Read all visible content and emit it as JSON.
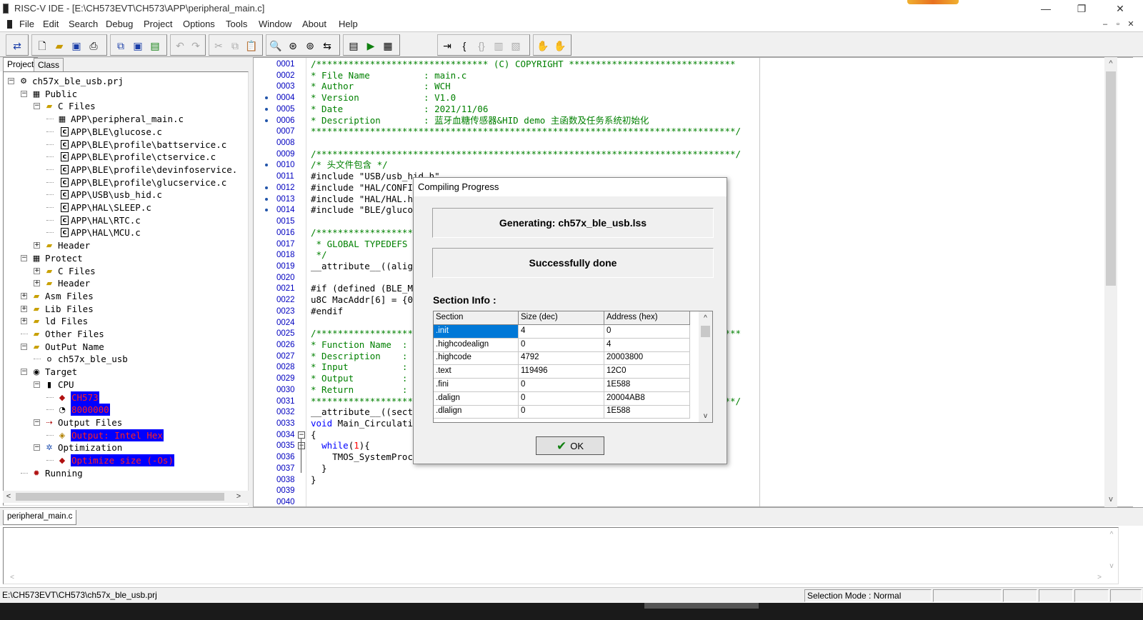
{
  "window": {
    "title": "RISC-V IDE - [E:\\CH573EVT\\CH573\\APP\\peripheral_main.c]",
    "controls": [
      "—",
      "❐",
      "✕"
    ],
    "mdi_controls": [
      "–",
      "▫",
      "✕"
    ]
  },
  "menu": [
    "File",
    "Edit",
    "Search",
    "Debug",
    "Project",
    "Options",
    "Tools",
    "Window",
    "About",
    "Help"
  ],
  "project_tabs": [
    "Project",
    "Class"
  ],
  "tree": [
    {
      "level": 0,
      "exp": "−",
      "icon": "project-icon",
      "glyph": "⚙",
      "label": "ch57x_ble_usb.prj"
    },
    {
      "level": 1,
      "exp": "−",
      "icon": "group-icon",
      "glyph": "▦",
      "label": "Public"
    },
    {
      "level": 2,
      "exp": "−",
      "icon": "folder-icon",
      "glyph": "▰",
      "label": "C Files"
    },
    {
      "level": 3,
      "exp": "",
      "icon": "active-file-icon",
      "glyph": "▦",
      "label": "APP\\peripheral_main.c"
    },
    {
      "level": 3,
      "exp": "",
      "icon": "c-file-icon",
      "glyph": "c",
      "label": "APP\\BLE\\glucose.c"
    },
    {
      "level": 3,
      "exp": "",
      "icon": "c-file-icon",
      "glyph": "c",
      "label": "APP\\BLE\\profile\\battservice.c"
    },
    {
      "level": 3,
      "exp": "",
      "icon": "c-file-icon",
      "glyph": "c",
      "label": "APP\\BLE\\profile\\ctservice.c"
    },
    {
      "level": 3,
      "exp": "",
      "icon": "c-file-icon",
      "glyph": "c",
      "label": "APP\\BLE\\profile\\devinfoservice."
    },
    {
      "level": 3,
      "exp": "",
      "icon": "c-file-icon",
      "glyph": "c",
      "label": "APP\\BLE\\profile\\glucservice.c"
    },
    {
      "level": 3,
      "exp": "",
      "icon": "c-file-icon",
      "glyph": "c",
      "label": "APP\\USB\\usb_hid.c"
    },
    {
      "level": 3,
      "exp": "",
      "icon": "c-file-icon",
      "glyph": "c",
      "label": "APP\\HAL\\SLEEP.c"
    },
    {
      "level": 3,
      "exp": "",
      "icon": "c-file-icon",
      "glyph": "c",
      "label": "APP\\HAL\\RTC.c"
    },
    {
      "level": 3,
      "exp": "",
      "icon": "c-file-icon",
      "glyph": "c",
      "label": "APP\\HAL\\MCU.c"
    },
    {
      "level": 2,
      "exp": "+",
      "icon": "folder-icon",
      "glyph": "▰",
      "label": "Header"
    },
    {
      "level": 1,
      "exp": "−",
      "icon": "group-icon",
      "glyph": "▦",
      "label": "Protect"
    },
    {
      "level": 2,
      "exp": "+",
      "icon": "folder-icon",
      "glyph": "▰",
      "label": "C Files"
    },
    {
      "level": 2,
      "exp": "+",
      "icon": "folder-icon",
      "glyph": "▰",
      "label": "Header"
    },
    {
      "level": 1,
      "exp": "+",
      "icon": "folder-icon",
      "glyph": "▰",
      "label": "Asm Files"
    },
    {
      "level": 1,
      "exp": "+",
      "icon": "folder-icon",
      "glyph": "▰",
      "label": "Lib Files"
    },
    {
      "level": 1,
      "exp": "+",
      "icon": "folder-icon",
      "glyph": "▰",
      "label": "ld Files"
    },
    {
      "level": 1,
      "exp": "",
      "icon": "folder-icon",
      "glyph": "▰",
      "label": "Other Files"
    },
    {
      "level": 1,
      "exp": "−",
      "icon": "folder-icon",
      "glyph": "▰",
      "label": "OutPut Name"
    },
    {
      "level": 2,
      "exp": "",
      "icon": "output-icon",
      "glyph": "o",
      "label": "ch57x_ble_usb"
    },
    {
      "level": 1,
      "exp": "−",
      "icon": "target-icon",
      "glyph": "◉",
      "label": "Target"
    },
    {
      "level": 2,
      "exp": "−",
      "icon": "cpu-icon",
      "glyph": "▮",
      "label": "CPU"
    },
    {
      "level": 3,
      "exp": "",
      "icon": "chip-icon",
      "glyph": "◆",
      "label": "CH573",
      "highlight": true
    },
    {
      "level": 3,
      "exp": "",
      "icon": "clock-icon",
      "glyph": "◔",
      "label": "8000000",
      "highlight": true
    },
    {
      "level": 2,
      "exp": "−",
      "icon": "output-files-icon",
      "glyph": "⇢",
      "label": "Output Files"
    },
    {
      "level": 3,
      "exp": "",
      "icon": "hex-icon",
      "glyph": "◈",
      "label": "Output: Intel Hex",
      "highlight": true
    },
    {
      "level": 2,
      "exp": "−",
      "icon": "optimization-icon",
      "glyph": "✲",
      "label": "Optimization"
    },
    {
      "level": 3,
      "exp": "",
      "icon": "optimize-icon",
      "glyph": "◆",
      "label": "Optimize size (-Os)",
      "highlight": true
    },
    {
      "level": 1,
      "exp": "",
      "icon": "running-icon",
      "glyph": "✹",
      "label": "Running"
    }
  ],
  "editor": {
    "lines": [
      {
        "n": "0001",
        "dot": false,
        "t": "/******************************** (C) COPYRIGHT *******************************",
        "c": "cm"
      },
      {
        "n": "0002",
        "dot": false,
        "t": "* File Name          : main.c",
        "c": "cm"
      },
      {
        "n": "0003",
        "dot": false,
        "t": "* Author             : WCH",
        "c": "cm"
      },
      {
        "n": "0004",
        "dot": true,
        "t": "* Version            : V1.0",
        "c": "cm"
      },
      {
        "n": "0005",
        "dot": true,
        "t": "* Date               : 2021/11/06",
        "c": "cm"
      },
      {
        "n": "0006",
        "dot": true,
        "t": "* Description        : 蓝牙血糖传感器&HID demo 主函数及任务系统初始化",
        "c": "cm"
      },
      {
        "n": "0007",
        "dot": false,
        "t": "*******************************************************************************/",
        "c": "cm"
      },
      {
        "n": "0008",
        "dot": false,
        "t": "",
        "c": ""
      },
      {
        "n": "0009",
        "dot": false,
        "t": "/******************************************************************************/",
        "c": "cm"
      },
      {
        "n": "0010",
        "dot": true,
        "t": "/* 头文件包含 */",
        "c": "cm"
      },
      {
        "n": "0011",
        "dot": false,
        "t": "#include \"USB/usb_hid.h\"",
        "c": "pp"
      },
      {
        "n": "0012",
        "dot": true,
        "t": "#include \"HAL/CONFIG.h\"",
        "c": "pp"
      },
      {
        "n": "0013",
        "dot": true,
        "t": "#include \"HAL/HAL.h\"",
        "c": "pp"
      },
      {
        "n": "0014",
        "dot": true,
        "t": "#include \"BLE/glucose.h\"",
        "c": "pp"
      },
      {
        "n": "0015",
        "dot": false,
        "t": "",
        "c": ""
      },
      {
        "n": "0016",
        "dot": false,
        "t": "/*********************************************************************",
        "c": "cm"
      },
      {
        "n": "0017",
        "dot": false,
        "t": " * GLOBAL TYPEDEFS",
        "c": "cm"
      },
      {
        "n": "0018",
        "dot": false,
        "t": " */",
        "c": "cm"
      },
      {
        "n": "0019",
        "dot": false,
        "t": "__attribute__((aligned(4))) u32 MEM_BUF[BLE_MEMHEAP_SIZE/4];",
        "c": ""
      },
      {
        "n": "0020",
        "dot": false,
        "t": "",
        "c": ""
      },
      {
        "n": "0021",
        "dot": false,
        "t": "#if (defined (BLE_MAC)) && (BLE_MAC == TRUE)",
        "c": "pp"
      },
      {
        "n": "0022",
        "dot": false,
        "t": "u8C MacAddr[6] = {0x84,0xC2,0xE4,0x03,0x02,0x02};",
        "c": ""
      },
      {
        "n": "0023",
        "dot": false,
        "t": "#endif",
        "c": "pp"
      },
      {
        "n": "0024",
        "dot": false,
        "t": "",
        "c": ""
      },
      {
        "n": "0025",
        "dot": false,
        "t": "/*******************************************************************************",
        "c": "cm"
      },
      {
        "n": "0026",
        "dot": false,
        "t": "* Function Name  : Main_Circulation",
        "c": "cm"
      },
      {
        "n": "0027",
        "dot": false,
        "t": "* Description    : 主循环",
        "c": "cm"
      },
      {
        "n": "0028",
        "dot": false,
        "t": "* Input          : None",
        "c": "cm"
      },
      {
        "n": "0029",
        "dot": false,
        "t": "* Output         : None",
        "c": "cm"
      },
      {
        "n": "0030",
        "dot": false,
        "t": "* Return         : None",
        "c": "cm"
      },
      {
        "n": "0031",
        "dot": false,
        "t": "*******************************************************************************/",
        "c": "cm"
      },
      {
        "n": "0032",
        "dot": false,
        "t": "__attribute__((section(\".highcode\")))",
        "c": ""
      },
      {
        "n": "0033",
        "dot": false,
        "t": "void Main_Circulation()",
        "c": "kwline"
      },
      {
        "n": "0034",
        "dot": false,
        "t": "{",
        "c": "",
        "fold": "−"
      },
      {
        "n": "0035",
        "dot": false,
        "t": "  while(1){",
        "c": "while",
        "fold": "−"
      },
      {
        "n": "0036",
        "dot": false,
        "t": "    TMOS_SystemProcess( );",
        "c": ""
      },
      {
        "n": "0037",
        "dot": false,
        "t": "  }",
        "c": ""
      },
      {
        "n": "0038",
        "dot": false,
        "t": "}",
        "c": ""
      },
      {
        "n": "0039",
        "dot": false,
        "t": "",
        "c": ""
      },
      {
        "n": "0040",
        "dot": false,
        "t": "",
        "c": ""
      }
    ]
  },
  "file_tab": "peripheral_main.c",
  "status": {
    "path": "E:\\CH573EVT\\CH573\\ch57x_ble_usb.prj",
    "mode": "Selection Mode : Normal"
  },
  "dialog": {
    "title": "Compiling Progress",
    "generating": "Generating: ch57x_ble_usb.lss",
    "result": "Successfully done",
    "section_label": "Section Info :",
    "columns": [
      "Section",
      "Size (dec)",
      "Address (hex)"
    ],
    "rows": [
      [
        ".init",
        "4",
        "0"
      ],
      [
        ".highcodealign",
        "0",
        "4"
      ],
      [
        ".highcode",
        "4792",
        "20003800"
      ],
      [
        ".text",
        "119496",
        "12C0"
      ],
      [
        ".fini",
        "0",
        "1E588"
      ],
      [
        ".dalign",
        "0",
        "20004AB8"
      ],
      [
        ".dlalign",
        "0",
        "1E588"
      ]
    ],
    "ok_label": "OK"
  }
}
